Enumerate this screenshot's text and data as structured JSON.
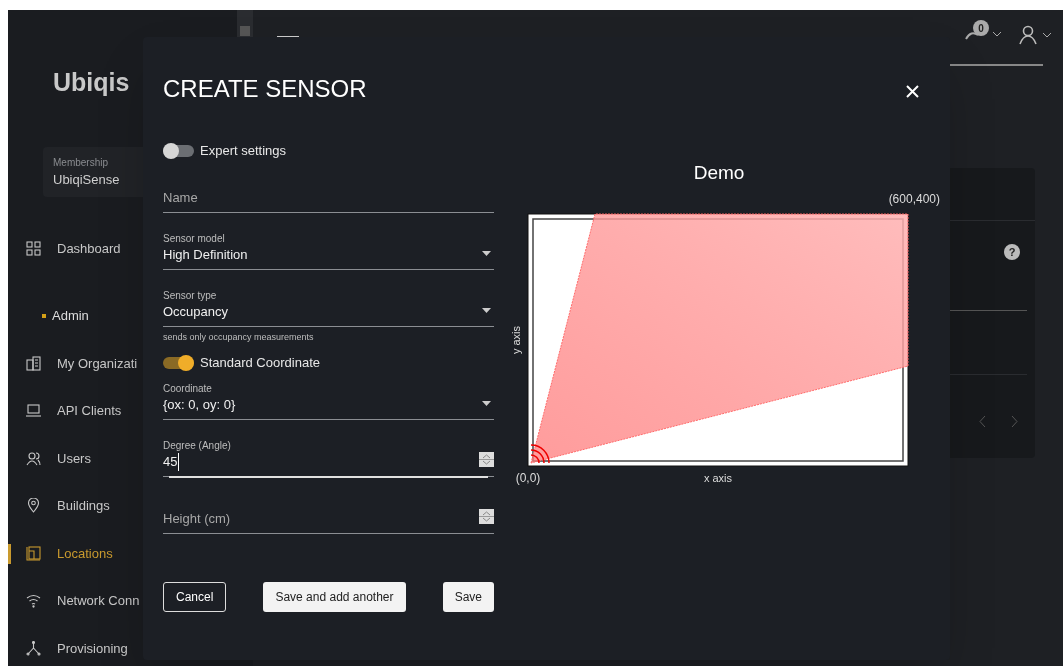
{
  "sidebar": {
    "logo": "Ubiqis",
    "membership": {
      "label": "Membership",
      "value": "UbiqiSense"
    },
    "items": [
      {
        "kind": "link",
        "label": "Dashboard",
        "selected": false
      },
      {
        "kind": "section",
        "label": "Admin"
      },
      {
        "kind": "link",
        "label": "My Organizati",
        "selected": false
      },
      {
        "kind": "link",
        "label": "API Clients",
        "selected": false
      },
      {
        "kind": "link",
        "label": "Users",
        "selected": false
      },
      {
        "kind": "link",
        "label": "Buildings",
        "selected": false
      },
      {
        "kind": "link",
        "label": "Locations",
        "selected": true
      },
      {
        "kind": "link",
        "label": "Network Conn",
        "selected": false
      },
      {
        "kind": "link",
        "label": "Provisioning",
        "selected": false
      }
    ]
  },
  "header": {
    "notification_count": "0"
  },
  "content_card": {
    "help_label": "?"
  },
  "dialog": {
    "title": "CREATE SENSOR",
    "expert_settings": {
      "label": "Expert settings",
      "on": false
    },
    "fields": [
      {
        "kind": "text",
        "placeholder": "Name"
      },
      {
        "kind": "select",
        "label": "Sensor model",
        "value": "High Definition"
      },
      {
        "kind": "select",
        "label": "Sensor type",
        "value": "Occupancy",
        "hint": "sends only occupancy measurements"
      },
      {
        "kind": "toggle",
        "label": "Standard Coordinate",
        "on": true
      },
      {
        "kind": "select",
        "label": "Coordinate",
        "value": "{ox: 0, oy: 0}"
      },
      {
        "kind": "number",
        "label": "Degree (Angle)",
        "value": "45",
        "focused": true
      },
      {
        "kind": "number",
        "placeholder": "Height (cm)",
        "focused": false
      }
    ],
    "buttons": [
      {
        "kind": "outline",
        "label": "Cancel"
      },
      {
        "kind": "filled",
        "label": "Save and add another"
      },
      {
        "kind": "filled",
        "label": "Save"
      }
    ],
    "demo": {
      "title": "Demo",
      "corner_label": "(600,400)",
      "origin_label": "(0,0)",
      "x_axis": "x axis",
      "y_axis": "y axis"
    }
  }
}
